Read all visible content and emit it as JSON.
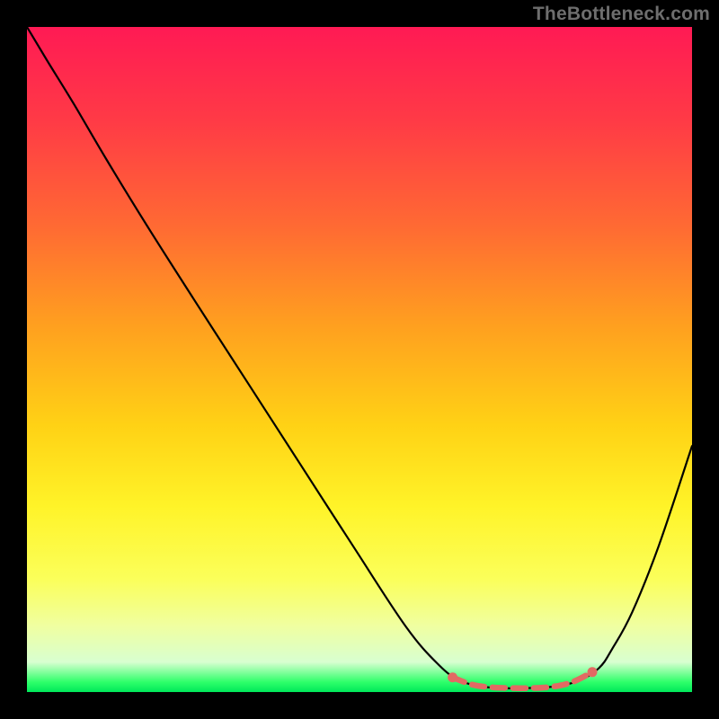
{
  "watermark": "TheBottleneck.com",
  "chart_data": {
    "type": "line",
    "title": "",
    "xlabel": "",
    "ylabel": "",
    "xlim": [
      0,
      100
    ],
    "ylim": [
      0,
      100
    ],
    "grid": false,
    "legend": false,
    "background_gradient_stops": [
      {
        "offset": 0.0,
        "color": "#ff1a54"
      },
      {
        "offset": 0.14,
        "color": "#ff3a46"
      },
      {
        "offset": 0.3,
        "color": "#ff6a33"
      },
      {
        "offset": 0.45,
        "color": "#ffa01f"
      },
      {
        "offset": 0.6,
        "color": "#ffd215"
      },
      {
        "offset": 0.72,
        "color": "#fff328"
      },
      {
        "offset": 0.83,
        "color": "#fbff5a"
      },
      {
        "offset": 0.9,
        "color": "#f0ffa0"
      },
      {
        "offset": 0.955,
        "color": "#d8ffd0"
      },
      {
        "offset": 0.985,
        "color": "#2eff6a"
      },
      {
        "offset": 1.0,
        "color": "#00e85a"
      }
    ],
    "series": [
      {
        "name": "main-curve",
        "color": "#000000",
        "stroke_width": 2.2,
        "x": [
          0.0,
          3.0,
          7.0,
          12.0,
          18.0,
          25.0,
          33.0,
          41.0,
          49.0,
          57.0,
          62.0,
          65.0,
          68.0,
          71.0,
          75.0,
          79.0,
          83.0,
          86.0,
          88.0,
          91.0,
          95.0,
          100.0
        ],
        "y": [
          100.0,
          95.0,
          88.5,
          80.0,
          70.2,
          59.2,
          46.8,
          34.4,
          22.0,
          9.8,
          4.0,
          1.8,
          0.9,
          0.6,
          0.6,
          0.8,
          1.7,
          3.6,
          6.5,
          12.0,
          22.0,
          37.0
        ]
      },
      {
        "name": "highlight-segment",
        "color": "#e26a63",
        "stroke_width": 6.5,
        "dash": "14 9",
        "x": [
          64.0,
          67.0,
          70.0,
          73.0,
          76.0,
          79.0,
          82.0,
          85.0
        ],
        "y": [
          2.2,
          1.1,
          0.7,
          0.6,
          0.6,
          0.8,
          1.5,
          3.0
        ],
        "endpoints": [
          {
            "x": 64.0,
            "y": 2.2
          },
          {
            "x": 85.0,
            "y": 3.0
          }
        ]
      }
    ]
  }
}
